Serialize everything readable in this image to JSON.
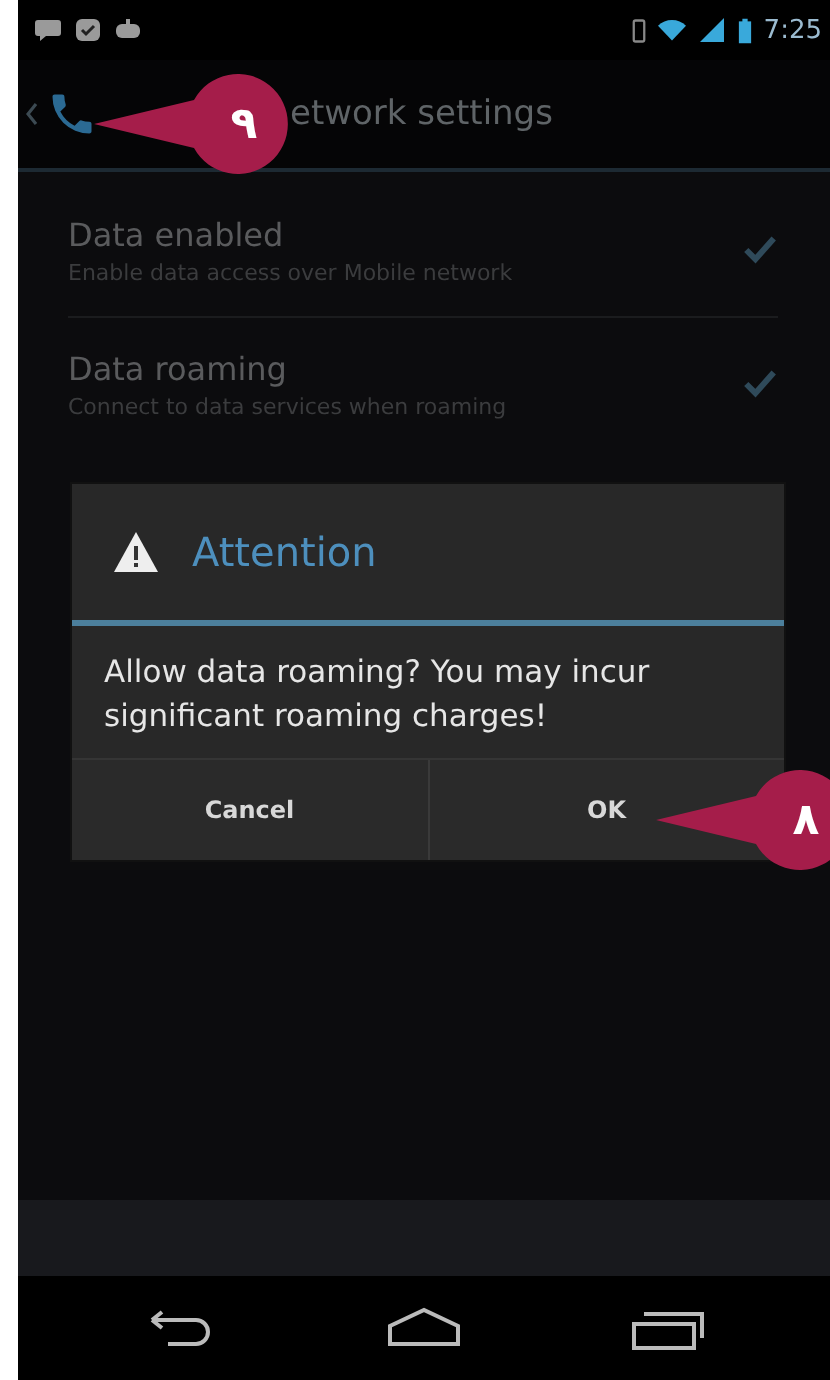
{
  "status_bar": {
    "time": "7:25"
  },
  "action_bar": {
    "title": "etwork settings"
  },
  "settings": [
    {
      "title": "Data enabled",
      "summary": "Enable data access over Mobile network",
      "checked": true
    },
    {
      "title": "Data roaming",
      "summary": "Connect to data services when roaming",
      "checked": true
    }
  ],
  "dialog": {
    "title": "Attention",
    "message": "Allow data roaming? You may incur significant roaming charges!",
    "buttons": [
      "Cancel",
      "OK"
    ]
  },
  "callouts": [
    {
      "label": "٩",
      "kind": "title"
    },
    {
      "label": "٨",
      "kind": "ok"
    }
  ]
}
